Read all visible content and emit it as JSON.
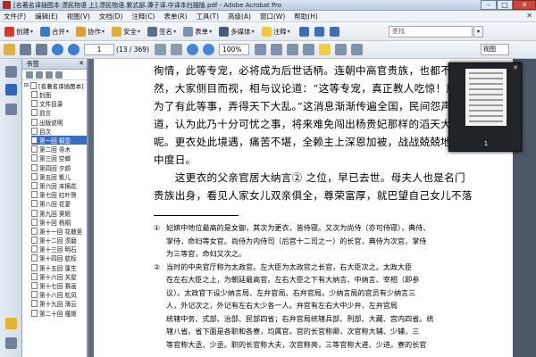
{
  "titlebar": {
    "title": "[名著名译插图本·漂民物语 上].漂民物语.紫式部.谭子译.中译本扫描版.pdf - Adobe Acrobat Pro",
    "minimize": "–",
    "maximize": "□",
    "close": "✕"
  },
  "menu": [
    "文件(F)",
    "编辑(E)",
    "视图(V)",
    "文档(D)",
    "注释(C)",
    "表单(R)",
    "工具(T)",
    "高级(A)",
    "窗口(W)",
    "帮助(H)"
  ],
  "menu_close": "✕",
  "toolbar1": {
    "create": "创建",
    "merge": "合并",
    "collaborate": "协作",
    "secure": "安全",
    "sign": "签名",
    "forms": "表单",
    "multimedia": "多媒体",
    "comment": "注释",
    "search_placeholder": "查找"
  },
  "toolbar2": {
    "page_current": "1",
    "page_of": "(13 / 369)",
    "zoom": "100%",
    "view_mode": "视图"
  },
  "bookmarks": {
    "panel_title": "书签",
    "root_label": "[名著名译插图本]",
    "items": [
      "封面",
      "文件目录",
      "前言",
      "出版说明",
      "目次",
      "第一回 桐壶",
      "第二回 帚木",
      "第三回 空蝉",
      "第四回 夕颜",
      "第五回 紫儿",
      "第六回 末摘花",
      "第七回 红叶贺",
      "第八回 花宴",
      "第九回 葵姬",
      "第十回 杨桐",
      "第十一回 花散里",
      "第十二回 须磨",
      "第十三回 明石",
      "第十四回 航标",
      "第十五回 蓬生",
      "第十六回 关屋",
      "第十七回 赛画",
      "第十八回 松风",
      "第十九回 薄云",
      "第二十回 槿姬"
    ],
    "selected_index": 5
  },
  "document": {
    "paragraphs": [
      "徇情，此等专宠，必将成为后世话柄。连朝中高官贵族，也都不以",
      "然，大家侧目而视，相与议论道：“这等专宠，真正教人吃惊！唐朝",
      "为了有此等事，弄得天下大乱。”这消息渐渐传遍全国，民间怨声",
      "道，认为此乃十分可忧之事，将来难免闯出杨贵妃那样的滔天大祸",
      "呢。更衣处此境遇，痛苦不堪，全赖主上深恩加被，战战兢兢地在",
      "中度日。",
      "　　这更衣的父亲官居大纳言② 之位，早已去世。母夫人也是名门",
      "贵族出身，看见人家女儿双亲俱全，尊荣富厚，就巴望自己女儿不落"
    ],
    "footnotes": [
      {
        "num": "①",
        "lines": [
          "妃嫔中地位最高的是女御，其次为更衣，皆侍寝。又次为尚侍（亦可侍寝），典侍、",
          "掌侍，命妇等女官。尚侍为内侍司（后宫十二司之一）的长官，典侍为次官，掌侍",
          "为三等官，命妇又次之。"
        ]
      },
      {
        "num": "②",
        "lines": [
          "当时的中央官厅称为太政官。左大臣为太政官之长官，右大臣次之。太政大臣",
          "在左右大臣之上，为朝廷最高官。左右大臣之下有大纳言、中纳言、宰相（即参",
          "议）。太政官下设少纳言局、左弁官局、右弁官局。少纳言局的官员有少纳言三",
          "人，外记次之，外记有左右大少各一人。弁官有左右大中少弁，左弁官局",
          "统辖中务、式部、治部、民部四省；右弁官局统辖兵部、刑部、大藏、宫内四省。统",
          "辖八省。省下面是各职和各寮，均属官。官的长官称卿，次官称大辅、少辅，三",
          "等官称大丞、少丞。职的长官称大夫，次官称亮，三等官称大进、少进。寮的长官"
        ]
      }
    ]
  },
  "thumbnail": {
    "page_label": "1",
    "close": "✕"
  }
}
